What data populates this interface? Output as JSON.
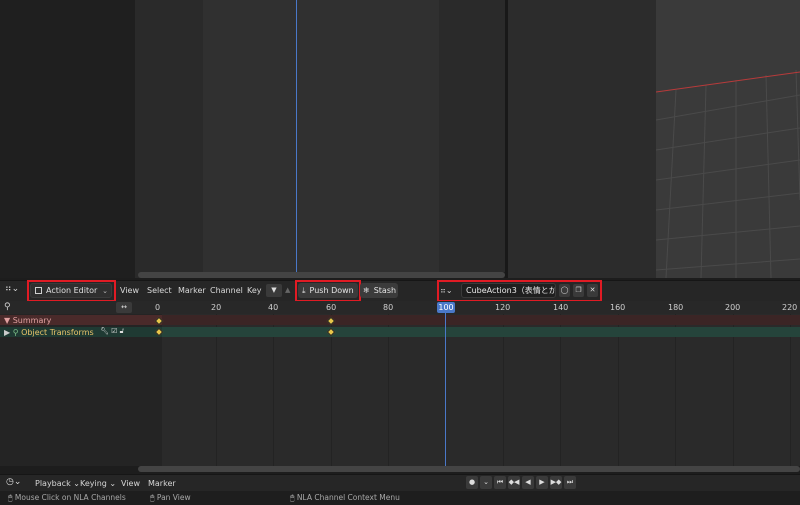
{
  "header": {
    "mode_label": "Action Editor",
    "menus": [
      "View",
      "Select",
      "Marker",
      "Channel",
      "Key"
    ],
    "push_down_label": "Push Down",
    "stash_label": "Stash",
    "action_name": "CubeAction3（表情とか）"
  },
  "timeline": {
    "ticks": [
      "0",
      "20",
      "40",
      "60",
      "80",
      "100",
      "120",
      "140",
      "160",
      "180",
      "200",
      "220"
    ],
    "current_frame": "100",
    "channels": {
      "summary": "Summary",
      "object_transforms": "Object Transforms"
    }
  },
  "footer": {
    "playback_label": "Playback",
    "keying_label": "Keying",
    "view_label": "View",
    "marker_label": "Marker"
  },
  "status_bar": {
    "items": [
      "Mouse Click on NLA Channels",
      "Pan View",
      "NLA Channel Context Menu"
    ]
  },
  "colors": {
    "highlight": "#e01b24",
    "playhead": "#4a78c8",
    "keyframe": "#e8c64a"
  }
}
